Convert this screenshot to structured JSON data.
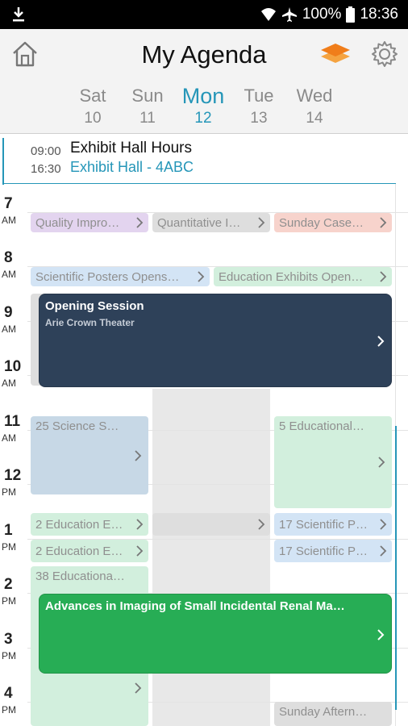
{
  "status_bar": {
    "battery": "100%",
    "time": "18:36",
    "icons": [
      "download-icon",
      "wifi-icon",
      "airplane-icon",
      "battery-icon"
    ]
  },
  "header": {
    "title": "My Agenda",
    "icons": [
      "home-icon",
      "layers-icon",
      "gear-icon"
    ],
    "colors": {
      "layers_top": "#f07d1a",
      "layers_bottom": "#f5a340"
    }
  },
  "days": [
    {
      "name": "Sat",
      "date": "10",
      "active": false
    },
    {
      "name": "Sun",
      "date": "11",
      "active": false
    },
    {
      "name": "Mon",
      "date": "12",
      "active": true
    },
    {
      "name": "Tue",
      "date": "13",
      "active": false
    },
    {
      "name": "Wed",
      "date": "14",
      "active": false
    }
  ],
  "all_day": {
    "start": "09:00",
    "end": "16:30",
    "title": "Exhibit Hall Hours",
    "location": "Exhibit Hall - 4ABC"
  },
  "hours": [
    {
      "h": "7",
      "ap": "AM"
    },
    {
      "h": "8",
      "ap": "AM"
    },
    {
      "h": "9",
      "ap": "AM"
    },
    {
      "h": "10",
      "ap": "AM"
    },
    {
      "h": "11",
      "ap": "AM"
    },
    {
      "h": "12",
      "ap": "PM"
    },
    {
      "h": "1",
      "ap": "PM"
    },
    {
      "h": "2",
      "ap": "PM"
    },
    {
      "h": "3",
      "ap": "PM"
    },
    {
      "h": "4",
      "ap": "PM"
    }
  ],
  "events": {
    "quality": "Quality Impro…",
    "quantitative": "Quantitative I…",
    "sunday_case": "Sunday Case…",
    "sci_posters": "Scientific Posters Opens…",
    "edu_exhibits": "Education Exhibits Open…",
    "science_25": "25 Science S…",
    "educational_5": "5 Educational…",
    "edu_2a": "2 Education E…",
    "sci_17a": "17 Scientific P…",
    "edu_2b": "2 Education E…",
    "sci_17b": "17 Scientific P…",
    "edu_38": "38 Educationa…",
    "sunday_afternoon": "Sunday Aftern…"
  },
  "featured": [
    {
      "title": "Opening Session",
      "subtitle": "Arie Crown Theater"
    },
    {
      "title": "Advances in Imaging of Small Incidental Renal Ma…"
    }
  ],
  "colors": {
    "accent": "#2596b8",
    "opening_session": "#2e4159",
    "advances_imaging": "#27ad55"
  }
}
